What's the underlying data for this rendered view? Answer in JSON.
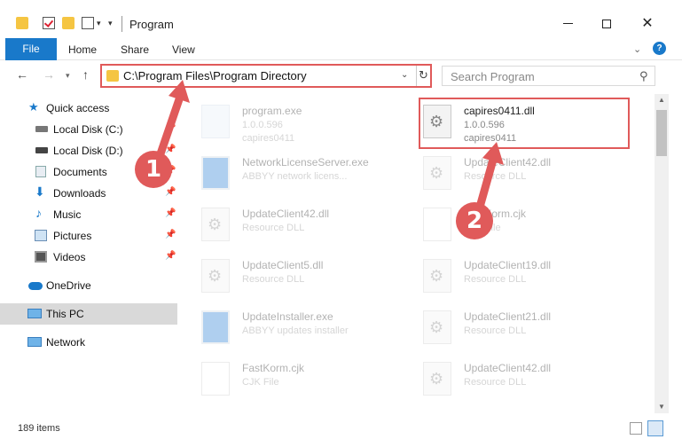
{
  "window": {
    "title": "Program",
    "minimize_icon": "minimize-icon",
    "maximize_icon": "maximize-icon",
    "close_icon": "close-icon"
  },
  "ribbon": {
    "tabs": [
      "File",
      "Home",
      "Share",
      "View"
    ],
    "active_tab": "File",
    "accent": "#1979ca"
  },
  "nav": {
    "address": "C:\\Program Files\\Program Directory",
    "search_placeholder": "Search Program"
  },
  "sidebar": {
    "items": [
      {
        "label": "Quick access",
        "icon": "star-icon"
      },
      {
        "label": "Local Disk (C:)",
        "icon": "drive-icon",
        "pinned": true
      },
      {
        "label": "Local Disk (D:)",
        "icon": "drive-icon",
        "pinned": true
      },
      {
        "label": "Documents",
        "icon": "documents-icon",
        "pinned": true
      },
      {
        "label": "Downloads",
        "icon": "download-icon",
        "pinned": true
      },
      {
        "label": "Music",
        "icon": "music-icon",
        "pinned": true
      },
      {
        "label": "Pictures",
        "icon": "pictures-icon",
        "pinned": true
      },
      {
        "label": "Videos",
        "icon": "videos-icon",
        "pinned": true
      },
      {
        "label": "OneDrive",
        "icon": "cloud-icon"
      },
      {
        "label": "This PC",
        "icon": "pc-icon",
        "selected": true
      },
      {
        "label": "Network",
        "icon": "network-icon"
      }
    ]
  },
  "files": [
    {
      "name": "program.exe",
      "line1": "1.0.0.596",
      "line2": "capires0411"
    },
    {
      "name": "capires0411.dll",
      "line1": "1.0.0.596",
      "line2": "capires0411"
    },
    {
      "name": "NetworkLicenseServer.exe",
      "line1": "ABBYY network licens...",
      "line2": ""
    },
    {
      "name": "UpdateClient42.dll",
      "line1": "Resource DLL",
      "line2": ""
    },
    {
      "name": "UpdateClient42.dll",
      "line1": "Resource DLL",
      "line2": ""
    },
    {
      "name": "FastKorm.cjk",
      "line1": "CJK File",
      "line2": ""
    },
    {
      "name": "UpdateClient5.dll",
      "line1": "Resource DLL",
      "line2": ""
    },
    {
      "name": "UpdateClient19.dll",
      "line1": "Resource DLL",
      "line2": ""
    },
    {
      "name": "UpdateInstaller.exe",
      "line1": "ABBYY updates installer",
      "line2": ""
    },
    {
      "name": "UpdateClient21.dll",
      "line1": "Resource DLL",
      "line2": ""
    },
    {
      "name": "FastKorm.cjk",
      "line1": "CJK File",
      "line2": ""
    },
    {
      "name": "UpdateClient42.dll",
      "line1": "Resource DLL",
      "line2": ""
    }
  ],
  "status": {
    "item_count": "189 items"
  },
  "annotations": {
    "marker1": "1",
    "marker2": "2",
    "color": "#e05a5a"
  }
}
